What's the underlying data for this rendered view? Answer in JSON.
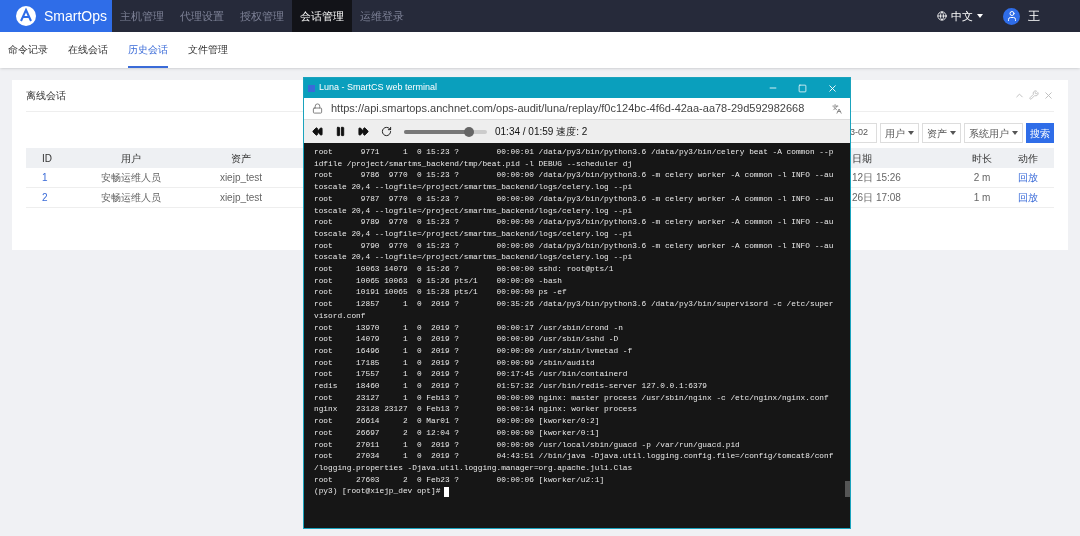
{
  "brand": "SmartOps",
  "nav": [
    {
      "label": "主机管理",
      "selected": false
    },
    {
      "label": "代理设置",
      "selected": false
    },
    {
      "label": "授权管理",
      "selected": false
    },
    {
      "label": "会话管理",
      "selected": true
    },
    {
      "label": "运维登录",
      "selected": false
    }
  ],
  "language": "中文",
  "user": "王",
  "subnav": [
    {
      "label": "命令记录",
      "selected": false
    },
    {
      "label": "在线会话",
      "selected": false
    },
    {
      "label": "历史会话",
      "selected": true
    },
    {
      "label": "文件管理",
      "selected": false
    }
  ],
  "card": {
    "title": "离线会话",
    "filters": {
      "date_value": "3-02",
      "selects": [
        "用户",
        "资产",
        "系统用户"
      ],
      "search_button": "搜索"
    },
    "table": {
      "columns": [
        "ID",
        "用户",
        "资产",
        "日期",
        "时长",
        "动作"
      ],
      "rows": [
        [
          "1",
          "安畅运维人员",
          "xiejp_test",
          "12日 15:26",
          "2 m",
          "回放"
        ],
        [
          "2",
          "安畅运维人员",
          "xiejp_test",
          "26日 17:08",
          "1 m",
          "回放"
        ]
      ]
    }
  },
  "terminal_window": {
    "title": "Luna - SmartCS web terminal",
    "url": "https://api.smartops.anchnet.com/ops-audit/luna/replay/f0c124bc-4f6d-42aa-aa78-29d592982668",
    "player": {
      "level": 0.78,
      "time": "01:34 / 01:59 速度: 2"
    },
    "lines": [
      "root      9771     1  0 15:23 ?        00:00:01 /data/py3/bin/python3.6 /data/py3/bin/celery beat -A common --p",
      "idfile /project/smartms_backend/tmp/beat.pid -l DEBUG --scheduler dj",
      "root      9786  9770  0 15:23 ?        00:00:00 /data/py3/bin/python3.6 -m celery worker -A common -l INFO --au",
      "toscale 20,4 --logfile=/project/smartms_backend/logs/celery.log --pi",
      "root      9787  9770  0 15:23 ?        00:00:00 /data/py3/bin/python3.6 -m celery worker -A common -l INFO --au",
      "toscale 20,4 --logfile=/project/smartms_backend/logs/celery.log --pi",
      "root      9789  9770  0 15:23 ?        00:00:00 /data/py3/bin/python3.6 -m celery worker -A common -l INFO --au",
      "toscale 20,4 --logfile=/project/smartms_backend/logs/celery.log --pi",
      "root      9790  9770  0 15:23 ?        00:00:00 /data/py3/bin/python3.6 -m celery worker -A common -l INFO --au",
      "toscale 20,4 --logfile=/project/smartms_backend/logs/celery.log --pi",
      "root     10063 14079  0 15:26 ?        00:00:00 sshd: root@pts/1",
      "root     10065 10063  0 15:26 pts/1    00:00:00 -bash",
      "root     10191 10065  0 15:28 pts/1    00:00:00 ps -ef",
      "root     12857     1  0  2019 ?        00:35:26 /data/py3/bin/python3.6 /data/py3/bin/supervisord -c /etc/super",
      "visord.conf",
      "root     13970     1  0  2019 ?        00:00:17 /usr/sbin/crond -n",
      "root     14079     1  0  2019 ?        00:00:09 /usr/sbin/sshd -D",
      "root     16496     1  0  2019 ?        00:00:00 /usr/sbin/lvmetad -f",
      "root     17185     1  0  2019 ?        00:00:09 /sbin/auditd",
      "root     17557     1  0  2019 ?        00:17:45 /usr/bin/containerd",
      "redis    18460     1  0  2019 ?        01:57:32 /usr/bin/redis-server 127.0.0.1:6379",
      "root     23127     1  0 Feb13 ?        00:00:00 nginx: master process /usr/sbin/nginx -c /etc/nginx/nginx.conf",
      "nginx    23128 23127  0 Feb13 ?        00:00:14 nginx: worker process",
      "root     26614     2  0 Mar01 ?        00:00:00 [kworker/0:2]",
      "root     26697     2  0 12:04 ?        00:00:00 [kworker/0:1]",
      "root     27011     1  0  2019 ?        00:00:00 /usr/local/sbin/guacd -p /var/run/guacd.pid",
      "root     27034     1  0  2019 ?        04:43:51 //bin/java -Djava.util.logging.config.file=/config/tomcat8/conf",
      "/logging.properties -Djava.util.logging.manager=org.apache.juli.Clas",
      "root     27603     2  0 Feb23 ?        00:00:06 [kworker/u2:1]"
    ],
    "prompt": "(py3) [root@xiejp_dev opt]#"
  }
}
